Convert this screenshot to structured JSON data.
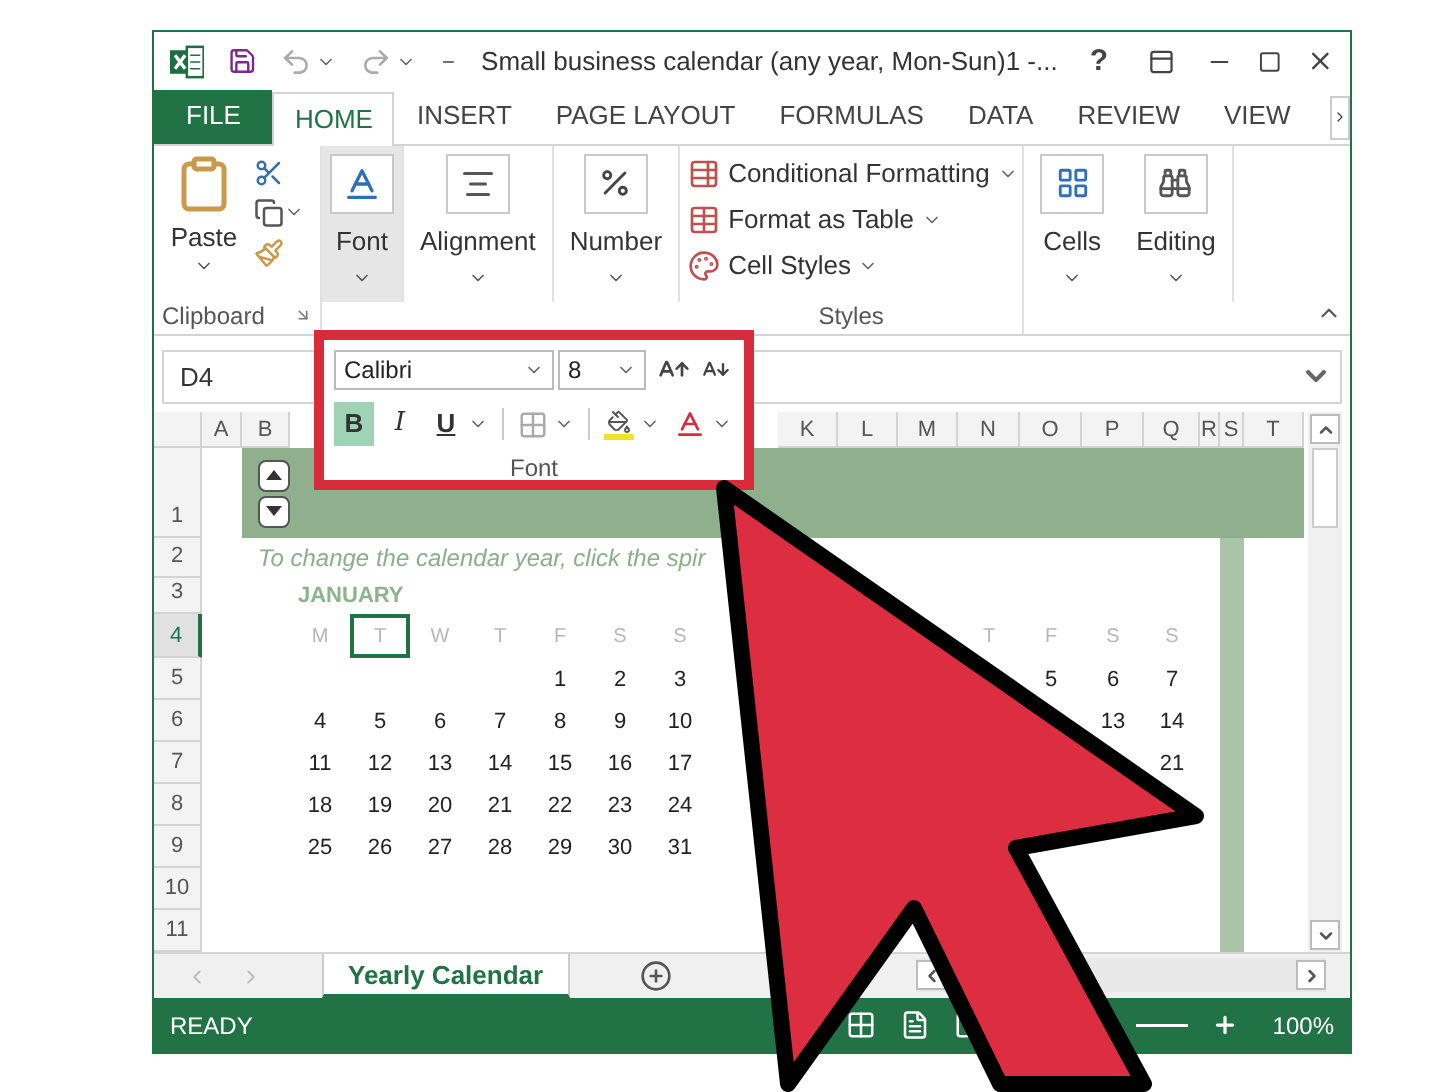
{
  "title_bar": {
    "title": "Small business calendar (any year, Mon-Sun)1 -...",
    "help": "?"
  },
  "tabs": [
    {
      "label": "FILE",
      "kind": "file",
      "selected": false
    },
    {
      "label": "HOME",
      "kind": "tab",
      "selected": true
    },
    {
      "label": "INSERT",
      "kind": "tab",
      "selected": false
    },
    {
      "label": "PAGE LAYOUT",
      "kind": "tab",
      "selected": false
    },
    {
      "label": "FORMULAS",
      "kind": "tab",
      "selected": false
    },
    {
      "label": "DATA",
      "kind": "tab",
      "selected": false
    },
    {
      "label": "REVIEW",
      "kind": "tab",
      "selected": false
    },
    {
      "label": "VIEW",
      "kind": "tab",
      "selected": false
    }
  ],
  "ribbon": {
    "paste": "Paste",
    "clipboard_label": "Clipboard",
    "font_button": {
      "label": "Font",
      "selected": true
    },
    "alignment": "Alignment",
    "number": "Number",
    "styles": [
      "Conditional Formatting",
      "Format as Table",
      "Cell Styles"
    ],
    "styles_label": "Styles",
    "cells": "Cells",
    "editing": "Editing"
  },
  "name_box": "D4",
  "font_popup": {
    "font_name": "Calibri",
    "font_size": "8",
    "group_label": "Font",
    "format_buttons": [
      {
        "label": "B",
        "kind": "bold",
        "selected": true
      },
      {
        "label": "I",
        "kind": "italic",
        "selected": false
      },
      {
        "label": "U",
        "kind": "underline",
        "selected": false
      }
    ]
  },
  "column_headers_left": [
    "A",
    "B"
  ],
  "column_headers_right": [
    "K",
    "L",
    "M",
    "N",
    "O",
    "P",
    "Q",
    "R",
    "S",
    "T"
  ],
  "row_headers": [
    {
      "label": "1",
      "selected": false
    },
    {
      "label": "2",
      "selected": false
    },
    {
      "label": "3",
      "selected": false
    },
    {
      "label": "4",
      "selected": true
    },
    {
      "label": "5",
      "selected": false
    },
    {
      "label": "6",
      "selected": false
    },
    {
      "label": "7",
      "selected": false
    },
    {
      "label": "8",
      "selected": false
    },
    {
      "label": "9",
      "selected": false
    },
    {
      "label": "10",
      "selected": false
    },
    {
      "label": "11",
      "selected": false
    }
  ],
  "sheet": {
    "hint": "To change the calendar year, click the spir",
    "calendar_left": {
      "month": "JANUARY",
      "weekdays": [
        {
          "label": "M",
          "selected": false
        },
        {
          "label": "T",
          "selected": true
        },
        {
          "label": "W",
          "selected": false
        },
        {
          "label": "T",
          "selected": false
        },
        {
          "label": "F",
          "selected": false
        },
        {
          "label": "S",
          "selected": false
        },
        {
          "label": "S",
          "selected": false
        }
      ],
      "weeks": [
        [
          "1",
          "2",
          "3"
        ],
        [
          "4",
          "5",
          "6",
          "7",
          "8",
          "9",
          "10"
        ],
        [
          "11",
          "12",
          "13",
          "14",
          "15",
          "16",
          "17"
        ],
        [
          "18",
          "19",
          "20",
          "21",
          "22",
          "23",
          "24"
        ],
        [
          "25",
          "26",
          "27",
          "28",
          "29",
          "30",
          "31"
        ]
      ]
    },
    "calendar_right": {
      "weekdays": [
        {
          "label": "T",
          "selected": false
        },
        {
          "label": "F",
          "selected": false
        },
        {
          "label": "S",
          "selected": false
        },
        {
          "label": "S",
          "selected": false
        }
      ],
      "weeks": [
        [
          "5",
          "6",
          "7"
        ],
        [
          "13",
          "14"
        ],
        [
          "21"
        ]
      ]
    }
  },
  "sheet_tabs": [
    {
      "label": "Yearly Calendar",
      "selected": true
    }
  ],
  "status_bar": {
    "status": "READY",
    "zoom": "100%"
  }
}
